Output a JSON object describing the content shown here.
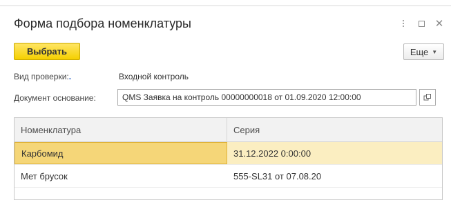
{
  "window": {
    "title": "Форма подбора номенклатуры"
  },
  "toolbar": {
    "select_label": "Выбрать",
    "more_label": "Еще"
  },
  "fields": {
    "check_type_label": "Вид проверки:",
    "check_type_value": "Входной контроль",
    "base_doc_label": "Документ основание:",
    "base_doc_value": "QMS Заявка на контроль 00000000018 от 01.09.2020 12:00:00"
  },
  "table": {
    "columns": [
      "Номенклатура",
      "Серия"
    ],
    "rows": [
      {
        "nomenclature": "Карбомид",
        "series": "31.12.2022 0:00:00",
        "selected": true
      },
      {
        "nomenclature": "Мет брусок",
        "series": "555-SL31 от 07.08.20",
        "selected": false
      }
    ]
  },
  "colors": {
    "accent_button": "#f5d000",
    "selected_row": "#fbeec1",
    "selected_cell": "#f5d678"
  }
}
